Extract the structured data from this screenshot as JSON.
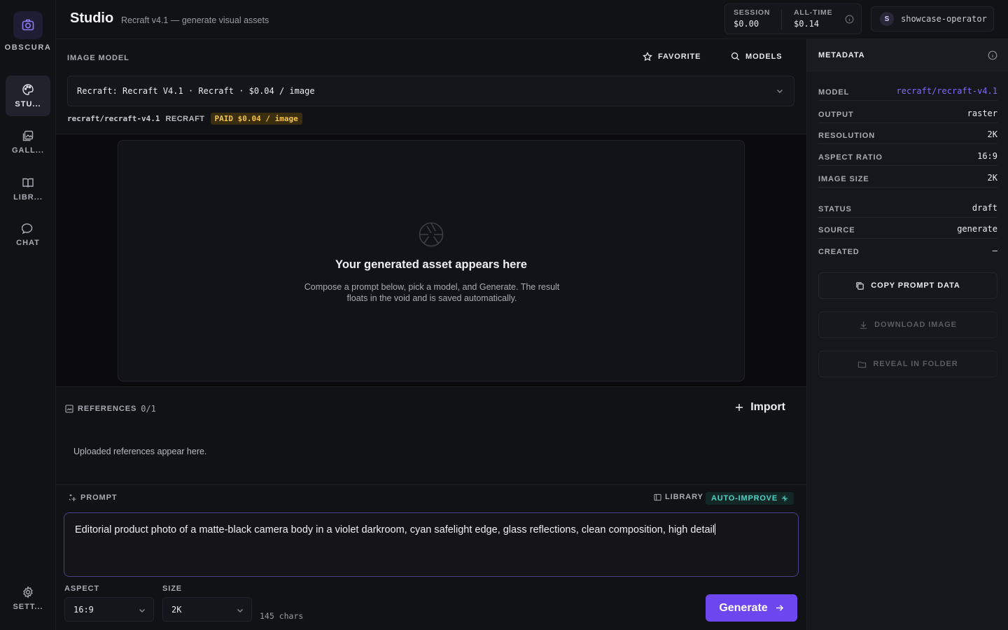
{
  "brand": {
    "name": "OBSCURA"
  },
  "nav": [
    {
      "label": "STU...",
      "icon": "palette-icon",
      "active": true
    },
    {
      "label": "GALL...",
      "icon": "gallery-icon"
    },
    {
      "label": "LIBR...",
      "icon": "book-icon"
    },
    {
      "label": "CHAT",
      "icon": "chat-icon"
    },
    {
      "label": "SETT...",
      "icon": "gear-icon"
    }
  ],
  "header": {
    "title": "Studio",
    "subtitle": "Recraft v4.1 — generate visual assets",
    "session_label": "SESSION",
    "session_value": "$0.00",
    "alltime_label": "ALL-TIME",
    "alltime_value": "$0.14",
    "user_initial": "S",
    "user_name": "showcase-operator"
  },
  "model_section": {
    "label": "IMAGE MODEL",
    "favorite_label": "FAVORITE",
    "models_label": "MODELS",
    "selected": "Recraft: Recraft V4.1 · Recraft · $0.04 / image",
    "model_id": "recraft/recraft-v4.1",
    "provider": "RECRAFT",
    "paid_badge": "PAID $0.04 / image"
  },
  "canvas": {
    "empty_title": "Your generated asset appears here",
    "empty_desc": "Compose a prompt below, pick a model, and Generate. The result floats in the void and is saved automatically."
  },
  "references": {
    "label": "REFERENCES",
    "count": "0/1",
    "import_label": "Import",
    "empty_text": "Uploaded references appear here."
  },
  "prompt": {
    "label": "PROMPT",
    "library_label": "LIBRARY",
    "auto_improve_label": "AUTO-IMPROVE",
    "text": "Editorial product photo of a matte-black camera body in a violet darkroom, cyan safelight edge, glass reflections, clean composition, high detail",
    "aspect_label": "ASPECT",
    "aspect_value": "16:9",
    "size_label": "SIZE",
    "size_value": "2K",
    "chars": "145 chars",
    "generate_label": "Generate"
  },
  "metadata": {
    "title": "METADATA",
    "rows": [
      {
        "k": "MODEL",
        "v": "recraft/recraft-v4.1"
      },
      {
        "k": "OUTPUT",
        "v": "raster"
      },
      {
        "k": "RESOLUTION",
        "v": "2K"
      },
      {
        "k": "ASPECT RATIO",
        "v": "16:9"
      },
      {
        "k": "IMAGE SIZE",
        "v": "2K"
      },
      {
        "k": "STATUS",
        "v": "draft"
      },
      {
        "k": "SOURCE",
        "v": "generate"
      },
      {
        "k": "CREATED",
        "v": "—"
      }
    ],
    "copy_label": "COPY PROMPT DATA",
    "download_label": "DOWNLOAD IMAGE",
    "reveal_label": "REVEAL IN FOLDER"
  },
  "colors": {
    "accent": "#6d46f0",
    "model_link": "#7f6cf5",
    "auto_improve": "#4fd1c5",
    "paid": "#f2c14a"
  }
}
